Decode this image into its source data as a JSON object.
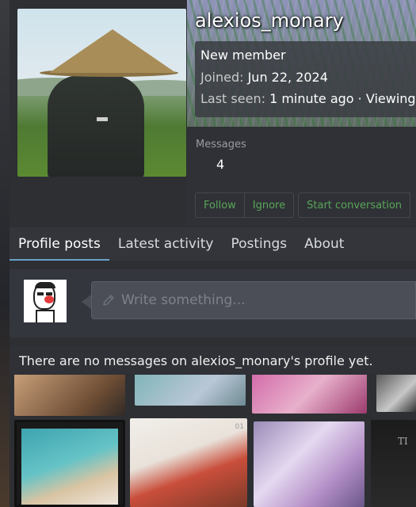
{
  "profile": {
    "username": "alexios_monary",
    "title": "New member",
    "joined_label": "Joined:",
    "joined_value": "Jun 22, 2024",
    "last_seen_label": "Last seen:",
    "last_seen_value": "1 minute ago · Viewing",
    "stats": {
      "messages_label": "Messages",
      "messages_value": "4"
    }
  },
  "actions": {
    "follow": "Follow",
    "ignore": "Ignore",
    "start_conversation": "Start conversation"
  },
  "tabs": [
    {
      "label": "Profile posts",
      "active": true
    },
    {
      "label": "Latest activity"
    },
    {
      "label": "Postings"
    },
    {
      "label": "About"
    }
  ],
  "composer": {
    "placeholder": "Write something..."
  },
  "empty_message": "There are no messages on alexios_monary's profile yet.",
  "background_text": {
    "tile_number": "01",
    "tile_letters": "TI"
  },
  "colors": {
    "accent_green": "#5aa65a",
    "tab_underline": "#6aa3c8",
    "panel": "#2f3136"
  }
}
